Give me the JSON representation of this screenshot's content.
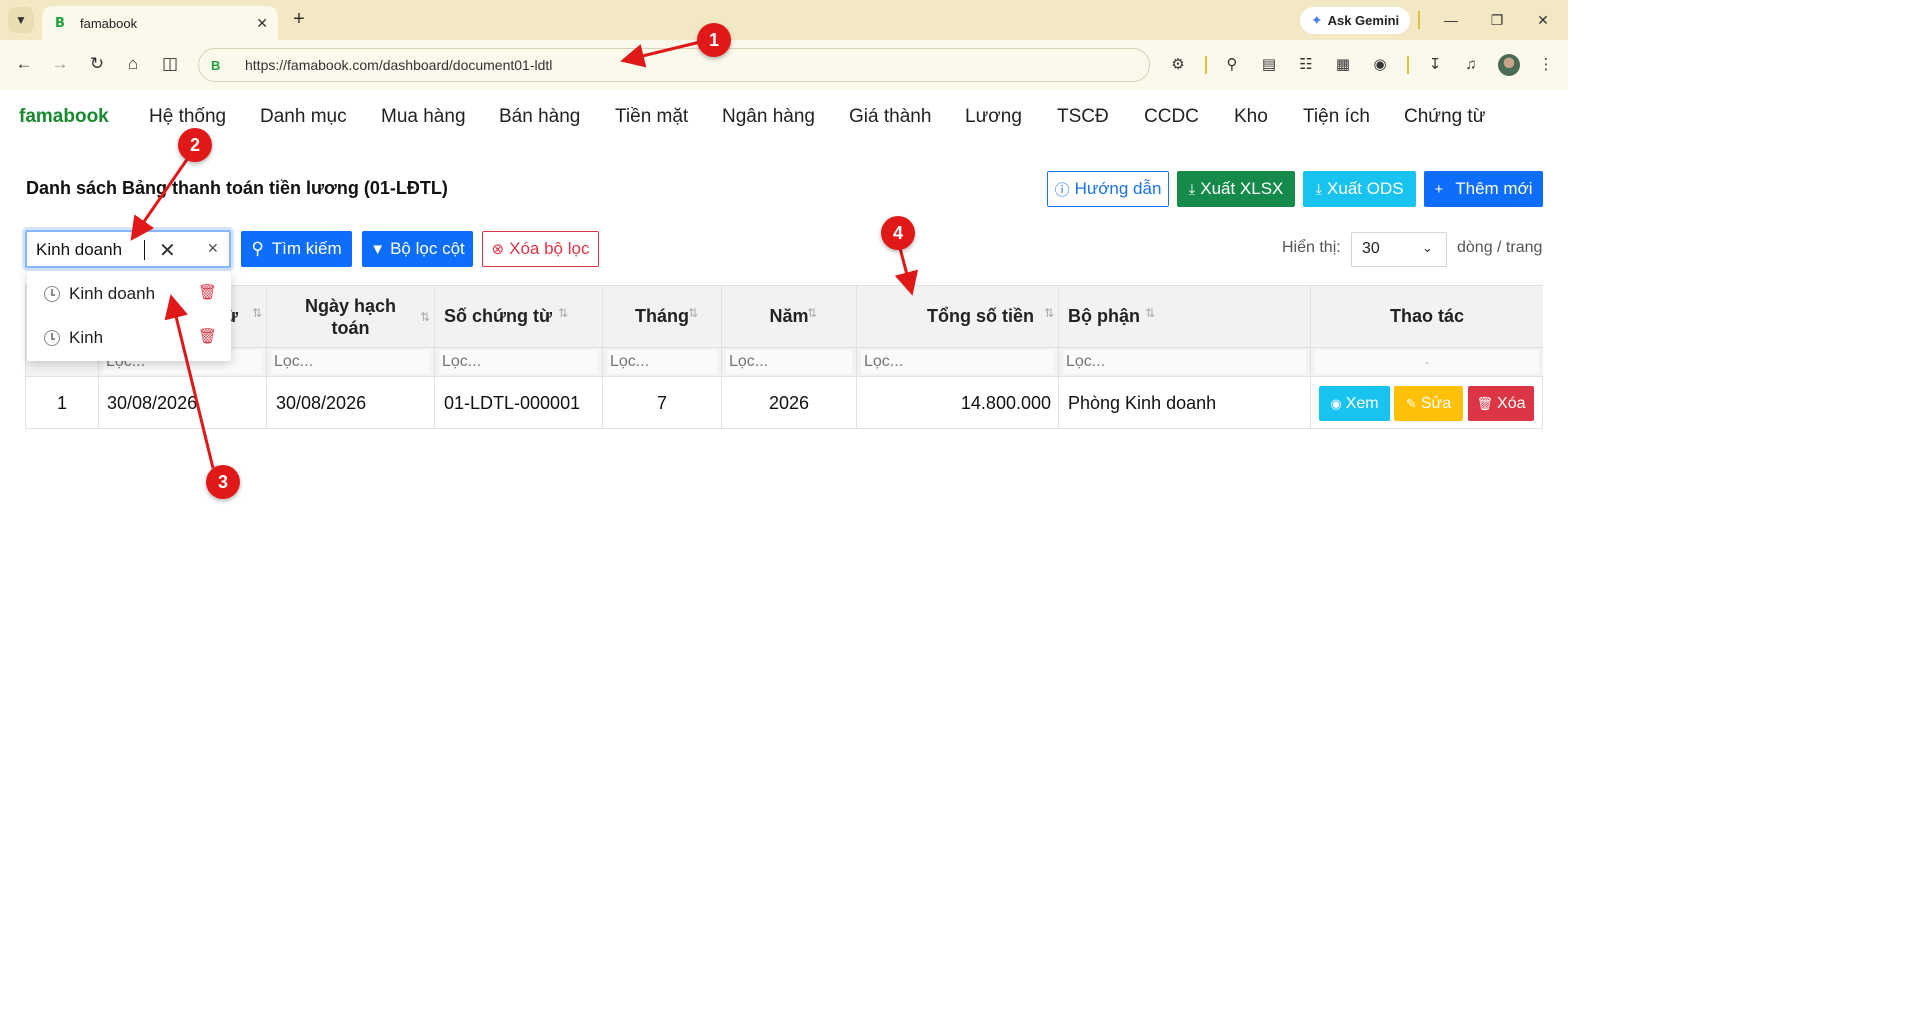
{
  "browser": {
    "tab_title": "famabook",
    "tab_favicon": "B",
    "url": "https://famabook.com/dashboard/document01-ldtl",
    "gemini_label": "Ask Gemini"
  },
  "app": {
    "brand": "famabook",
    "menu": [
      "Hệ thống",
      "Danh mục",
      "Mua hàng",
      "Bán hàng",
      "Tiền mặt",
      "Ngân hàng",
      "Giá thành",
      "Lương",
      "TSCĐ",
      "CCDC",
      "Kho",
      "Tiện ích",
      "Chứng từ"
    ]
  },
  "page": {
    "title": "Danh sách Bảng thanh toán tiền lương (01-LĐTL)",
    "buttons": {
      "guide": "Hướng dẫn",
      "export_xlsx": "Xuất XLSX",
      "export_ods": "Xuất ODS",
      "add_new": "Thêm mới",
      "search": "Tìm kiếm",
      "column_filter": "Bộ lọc cột",
      "clear_filter": "Xóa bộ lọc"
    },
    "search_value": "Kinh doanh",
    "search_history": [
      "Kinh doanh",
      "Kinh"
    ],
    "show_label": "Hiển thị:",
    "page_size": "30",
    "per_page_label": "dòng / trang"
  },
  "table": {
    "headers": {
      "voucher_date": "ừ",
      "posting_date_line1": "Ngày hạch",
      "posting_date_line2": "toán",
      "voucher_no": "Số chứng từ",
      "month": "Tháng",
      "year": "Năm",
      "total": "Tổng số tiền",
      "department": "Bộ phận",
      "actions": "Thao tác"
    },
    "filter_placeholder": "Lọc...",
    "actions_filter": "-",
    "rows": [
      {
        "stt": "1",
        "voucher_date": "30/08/2026",
        "posting_date": "30/08/2026",
        "voucher_no": "01-LDTL-000001",
        "month": "7",
        "year": "2026",
        "total": "14.800.000",
        "department": "Phòng Kinh doanh"
      }
    ],
    "row_actions": {
      "view": "Xem",
      "edit": "Sửa",
      "delete": "Xóa"
    }
  },
  "annotations": [
    "1",
    "2",
    "3",
    "4"
  ],
  "colors": {
    "brand": "#1a8a2e",
    "primary": "#0d6efd",
    "export_xlsx": "#168a4a",
    "export_ods": "#19c3f0",
    "view": "#19c3f0",
    "edit": "#ffc107",
    "delete": "#dc3545",
    "annotation": "#e01818"
  }
}
